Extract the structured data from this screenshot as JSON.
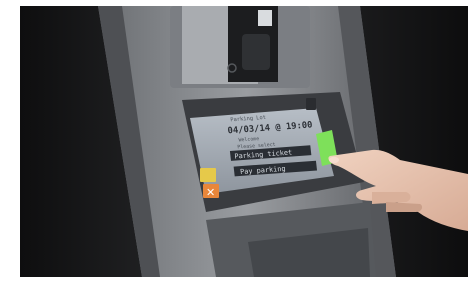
{
  "kiosk": {
    "screen": {
      "header_line": "Parking Lot",
      "datetime": "04/03/14 @ 19:00",
      "info_line_1": "Welcome",
      "info_line_2": "Please select",
      "highlight_line": "Parking ticket",
      "option_line": "Pay parking"
    },
    "buttons": {
      "cancel_symbol": "✕"
    },
    "colors": {
      "body": "#8a8d92",
      "screen": "#9aa2ac",
      "confirm_button": "#7ee05a",
      "cancel_button": "#e8863a",
      "yellow_button": "#e6c94a"
    }
  }
}
